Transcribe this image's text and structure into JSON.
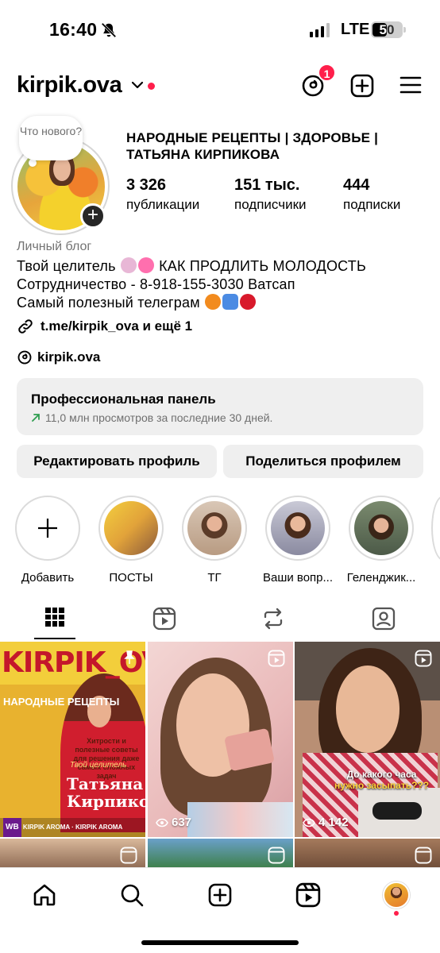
{
  "status_bar": {
    "time": "16:40",
    "network": "LTE",
    "battery": "50",
    "icons": [
      "bell-slash-icon",
      "signal-icon",
      "battery-icon"
    ]
  },
  "header": {
    "username": "kirpik.ova",
    "threads_badge": "1",
    "icons": [
      "chevron-down-icon",
      "threads-icon",
      "add-post-icon",
      "menu-icon"
    ]
  },
  "profile": {
    "note_text": "Что нового?",
    "full_name": "НАРОДНЫЕ РЕЦЕПТЫ | ЗДОРОВЬЕ | ТАТЬЯНА КИРПИКОВА",
    "stats": [
      {
        "value": "3 326",
        "label": "публикации"
      },
      {
        "value": "151 тыс.",
        "label": "подписчики"
      },
      {
        "value": "444",
        "label": "подписки"
      }
    ],
    "category": "Личный блог",
    "bio_line1": "Твой целитель",
    "bio_line1_tail": "КАК ПРОДЛИТЬ МОЛОДОСТЬ",
    "bio_line2": "Сотрудничество - 8-918-155-3030 Ватсап",
    "bio_line3": "Самый полезный телеграм",
    "link": "t.me/kirpik_ova и ещё 1",
    "threads_handle": "kirpik.ova"
  },
  "pro_panel": {
    "title": "Профессиональная панель",
    "subtitle": "11,0 млн просмотров за последние 30 дней."
  },
  "actions": {
    "edit": "Редактировать профиль",
    "share": "Поделиться профилем"
  },
  "highlights": [
    {
      "label": "Добавить"
    },
    {
      "label": "ПОСТЫ"
    },
    {
      "label": "ТГ"
    },
    {
      "label": "Ваши вопр..."
    },
    {
      "label": "Геленджик..."
    }
  ],
  "tabs": [
    "grid-icon",
    "reels-icon",
    "reposts-icon",
    "tagged-icon"
  ],
  "posts": [
    {
      "title": "KIRPIK_OVA",
      "subtitle": "НАРОДНЫЕ РЕЦЕПТЫ",
      "tagline": "Твой целитель",
      "name": "Татьяна Кирпикова",
      "text": "Хитрости и полезные советы для решения даже самых сложных задач",
      "footer_wb": "WB",
      "footer_a": "KIRPIK AROMA",
      "footer_b": "KIRPIK AROMA"
    },
    {
      "views": "637"
    },
    {
      "views": "4 142",
      "caption_a": "До какого часа",
      "caption_b": "нужно засыпать???"
    }
  ],
  "bottom_nav": [
    "home-icon",
    "search-icon",
    "create-icon",
    "reels-icon",
    "profile-avatar"
  ]
}
